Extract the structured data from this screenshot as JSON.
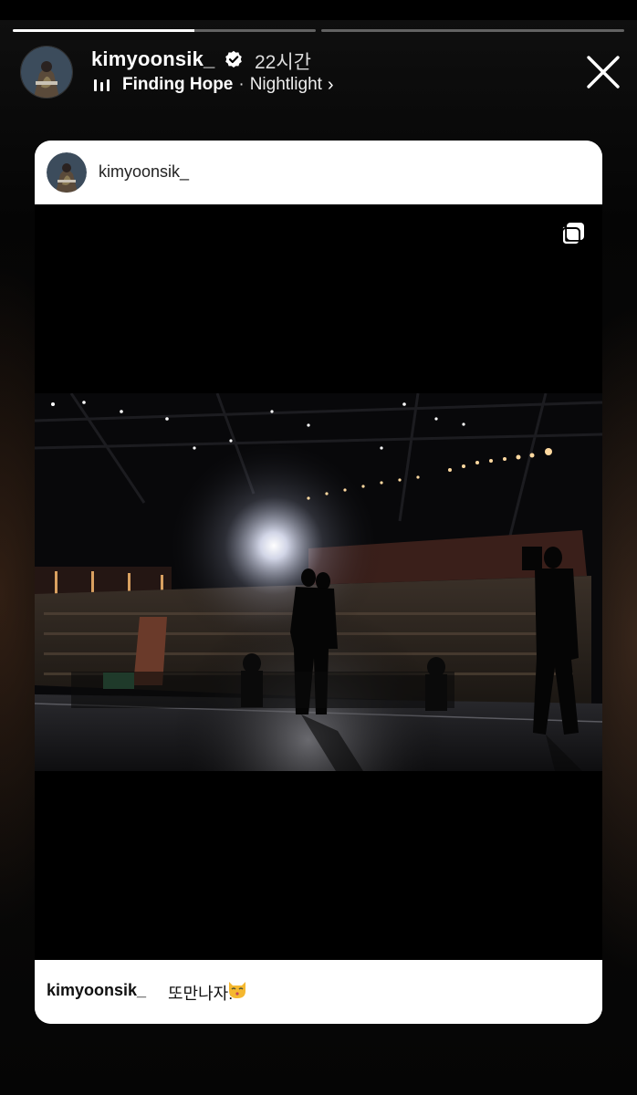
{
  "story": {
    "progress_segments": [
      {
        "fill": 0.6
      },
      {
        "fill": 0.0
      }
    ],
    "username": "kimyoonsik_",
    "verified": true,
    "time_ago": "22시간",
    "music": {
      "icon": "equalizer-icon",
      "song": "Finding Hope",
      "separator": "·",
      "artist": "Nightlight",
      "chevron": "›"
    },
    "close_icon": "close-icon"
  },
  "post": {
    "username": "kimyoonsik_",
    "multi_icon": "carousel-icon",
    "photo_description_icon": "concert-stage-photo",
    "caption_user": "kimyoonsik_",
    "caption_text": "또만나자!",
    "caption_emoji": "kissing-cat-emoji"
  },
  "colors": {
    "background": "#000000",
    "card": "#ffffff",
    "progress_track": "rgba(255,255,255,0.35)",
    "progress_fill": "#ffffff",
    "verified_badge": "#ffffff"
  }
}
